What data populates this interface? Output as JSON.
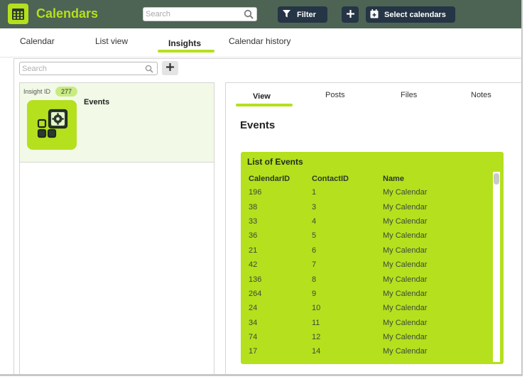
{
  "app": {
    "title": "Calendars",
    "search_placeholder": "Search",
    "filter_label": "Filter",
    "add_label": "+",
    "select_calendars_label": "Select calendars",
    "accent_color": "#b4e01e",
    "header_color": "#4d6354",
    "button_color": "#253545"
  },
  "main_tabs": [
    {
      "label": "Calendar"
    },
    {
      "label": "List view"
    },
    {
      "label": "Insights",
      "active": true
    },
    {
      "label": "Calendar history"
    }
  ],
  "sub_toolbar": {
    "search_placeholder": "Search",
    "add_label": "+"
  },
  "insight_card": {
    "id_label": "Insight ID",
    "id_value": "277",
    "title": "Events",
    "icon": "dashboard-gear-icon"
  },
  "detail_tabs": [
    {
      "label": "View",
      "active": true
    },
    {
      "label": "Posts"
    },
    {
      "label": "Files"
    },
    {
      "label": "Notes"
    }
  ],
  "section_title": "Events",
  "events_list": {
    "title": "List of Events",
    "columns": [
      "CalendarID",
      "ContactID",
      "Name"
    ],
    "rows": [
      [
        "196",
        "1",
        "My Calendar"
      ],
      [
        "38",
        "3",
        "My Calendar"
      ],
      [
        "33",
        "4",
        "My Calendar"
      ],
      [
        "36",
        "5",
        "My Calendar"
      ],
      [
        "21",
        "6",
        "My Calendar"
      ],
      [
        "42",
        "7",
        "My Calendar"
      ],
      [
        "136",
        "8",
        "My Calendar"
      ],
      [
        "264",
        "9",
        "My Calendar"
      ],
      [
        "24",
        "10",
        "My Calendar"
      ],
      [
        "34",
        "11",
        "My Calendar"
      ],
      [
        "74",
        "12",
        "My Calendar"
      ],
      [
        "17",
        "14",
        "My Calendar"
      ]
    ]
  }
}
